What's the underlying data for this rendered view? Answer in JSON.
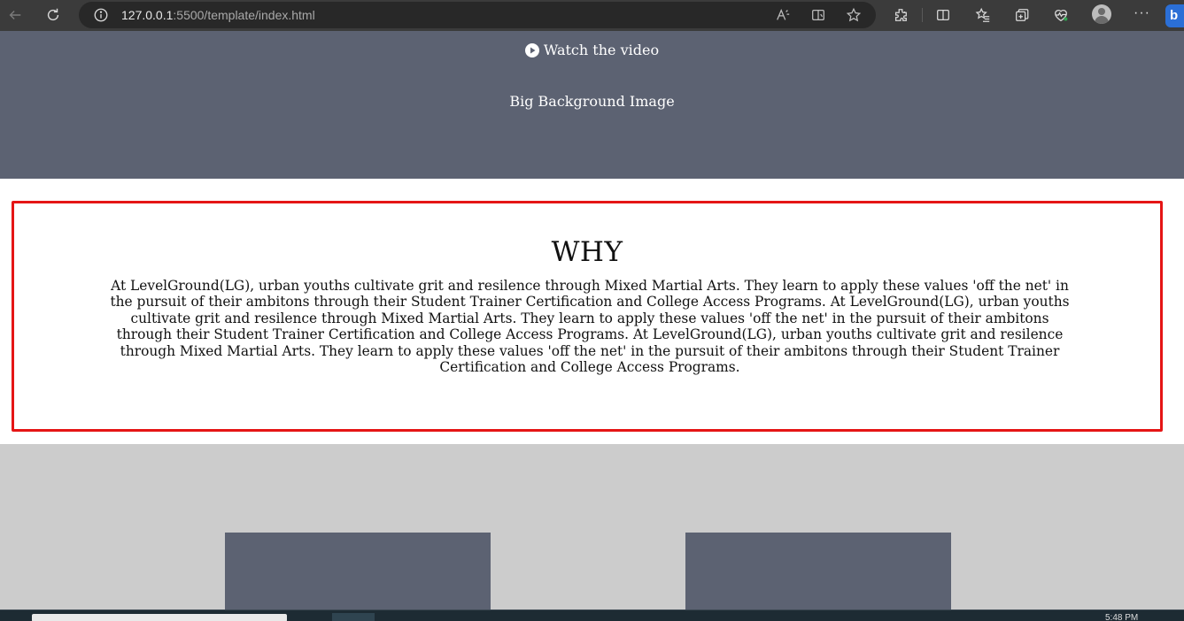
{
  "browser": {
    "url_host": "127.0.0.1",
    "url_rest": ":5500/template/index.html",
    "toolbar_icons": [
      "back-arrow-icon",
      "reload-icon",
      "info-icon",
      "read-aloud-icon",
      "immersive-reader-icon",
      "favorite-star-icon",
      "extensions-icon",
      "split-screen-icon",
      "favorites-list-icon",
      "collections-icon",
      "health-icon",
      "profile-avatar",
      "more-icon",
      "bing-icon"
    ],
    "more_label": "···",
    "bing_label": "b"
  },
  "hero": {
    "watch_label": "Watch the video",
    "background_label": "Big Background Image",
    "bg_color": "#5c6272"
  },
  "why": {
    "title": "WHY",
    "body": "At LevelGround(LG), urban youths cultivate grit and resilence through Mixed Martial Arts. They learn to apply these values 'off the net' in the pursuit of their ambitons through their Student Trainer Certification and College Access Programs. At LevelGround(LG), urban youths cultivate grit and resilence through Mixed Martial Arts. They learn to apply these values 'off the net' in the pursuit of their ambitons through their Student Trainer Certification and College Access Programs. At LevelGround(LG), urban youths cultivate grit and resilence through Mixed Martial Arts. They learn to apply these values 'off the net' in the pursuit of their ambitons through their Student Trainer Certification and College Access Programs.",
    "border_color": "#e51515"
  },
  "section_gray": {
    "bg_color": "#cccccc",
    "cards": 2
  },
  "taskbar": {
    "clock": "5:48 PM"
  }
}
